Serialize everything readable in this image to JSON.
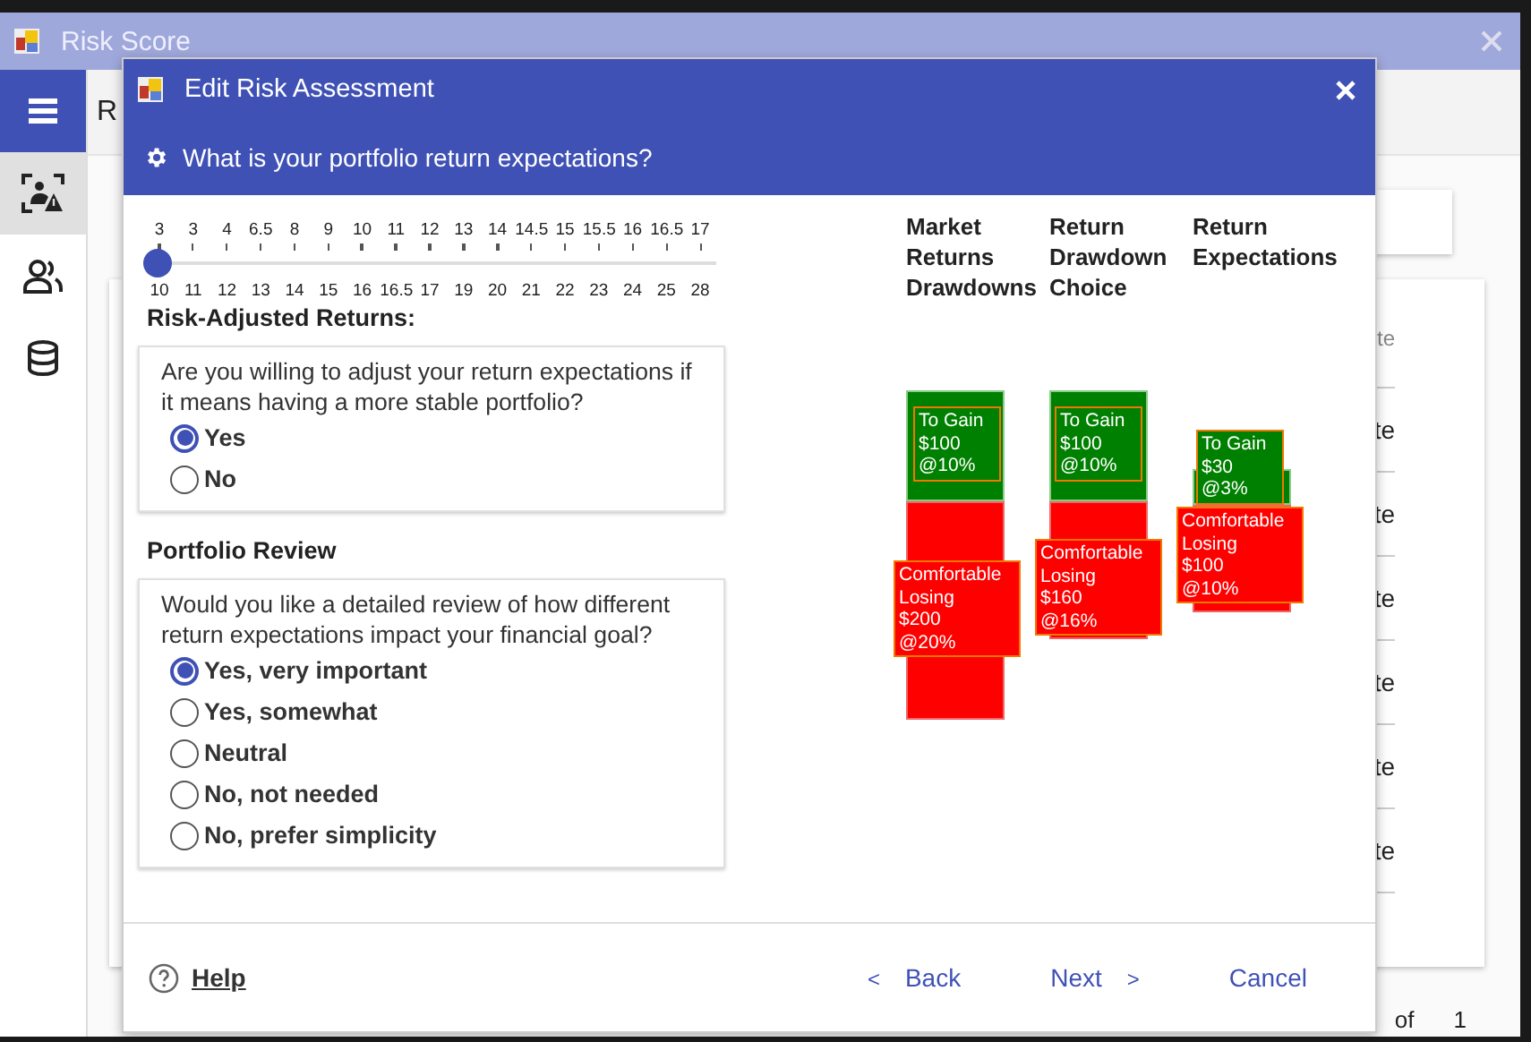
{
  "window": {
    "title": "Risk Score"
  },
  "sidebar": {
    "items": [
      {
        "kind": "menu",
        "selected": false
      },
      {
        "kind": "risk",
        "selected": true
      },
      {
        "kind": "people",
        "selected": false
      },
      {
        "kind": "database",
        "selected": false
      }
    ]
  },
  "page": {
    "title_partial": "R",
    "table": {
      "header": "te",
      "rows": [
        "te",
        "te",
        "te",
        "te",
        "te",
        "te"
      ]
    },
    "pager": {
      "of": "of",
      "total": "1"
    }
  },
  "dialog": {
    "title": "Edit Risk Assessment",
    "question": "What is your portfolio return expectations?",
    "slider": {
      "top_labels": [
        "3",
        "3",
        "4",
        "6.5",
        "8",
        "9",
        "10",
        "11",
        "12",
        "13",
        "14",
        "14.5",
        "15",
        "15.5",
        "16",
        "16.5",
        "17"
      ],
      "bottom_labels": [
        "10",
        "11",
        "12",
        "13",
        "14",
        "15",
        "16",
        "16.5",
        "17",
        "19",
        "20",
        "21",
        "22",
        "23",
        "24",
        "25",
        "28"
      ],
      "level": 0
    },
    "sections": [
      {
        "heading": "Risk-Adjusted Returns:",
        "prompt": "Are you willing to adjust your return expectations if it means having a more stable portfolio?",
        "options": [
          {
            "label": "Yes",
            "selected": true
          },
          {
            "label": "No",
            "selected": false
          }
        ]
      },
      {
        "heading": "Portfolio Review",
        "prompt": "Would you like a detailed review of how different return expectations impact your financial goal?",
        "options": [
          {
            "label": "Yes, very important",
            "selected": true
          },
          {
            "label": "Yes, somewhat",
            "selected": false
          },
          {
            "label": "Neutral",
            "selected": false
          },
          {
            "label": "No, not needed",
            "selected": false
          },
          {
            "label": "No, prefer simplicity",
            "selected": false
          }
        ]
      }
    ],
    "chart": {
      "columns": [
        {
          "header": [
            "Market",
            "Returns",
            "Drawdowns"
          ],
          "gain": [
            "To Gain",
            "$100",
            "@10%"
          ],
          "loss": [
            "Comfortable",
            "Losing",
            "$200",
            "@20%"
          ]
        },
        {
          "header": [
            "Return",
            "Drawdown",
            "Choice"
          ],
          "gain": [
            "To Gain",
            "$100",
            "@10%"
          ],
          "loss": [
            "Comfortable",
            "Losing",
            "$160",
            "@16%"
          ]
        },
        {
          "header": [
            "Return",
            "Expectations"
          ],
          "gain": [
            "To Gain",
            "$30",
            "@3%"
          ],
          "loss": [
            "Comfortable",
            "Losing",
            "$100",
            "@10%"
          ]
        }
      ]
    },
    "footer": {
      "help": "Help",
      "back_arrow": "<",
      "back": "Back",
      "next": "Next",
      "next_arrow": ">",
      "cancel": "Cancel"
    }
  }
}
